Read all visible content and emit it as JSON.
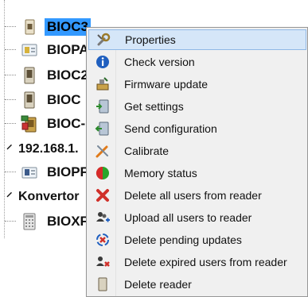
{
  "tree": {
    "nodes": [
      {
        "label": "BIOC3",
        "icon": "reader-device-icon",
        "selected": true
      },
      {
        "label": "BIOPA",
        "icon": "reader-device-icon"
      },
      {
        "label": "BIOC2",
        "icon": "reader-device-icon"
      },
      {
        "label": "BIOC",
        "icon": "reader-device-icon"
      },
      {
        "label": "BIOC-",
        "icon": "reader-device-icon"
      },
      {
        "label": "192.168.1.",
        "icon": "network-group"
      },
      {
        "label": "BIOPF",
        "icon": "reader-device-icon"
      },
      {
        "label": "Konvertor",
        "icon": "converter-group"
      },
      {
        "label": "BIOXF",
        "icon": "keypad-reader-icon"
      }
    ]
  },
  "context_menu": {
    "items": [
      {
        "label": "Properties",
        "icon": "properties-icon",
        "highlighted": true
      },
      {
        "label": "Check version",
        "icon": "info-icon"
      },
      {
        "label": "Firmware update",
        "icon": "firmware-update-icon"
      },
      {
        "label": "Get settings",
        "icon": "get-settings-icon"
      },
      {
        "label": "Send configuration",
        "icon": "send-configuration-icon"
      },
      {
        "label": "Calibrate",
        "icon": "calibrate-icon"
      },
      {
        "label": "Memory status",
        "icon": "memory-status-icon"
      },
      {
        "label": "Delete all users from reader",
        "icon": "delete-users-icon"
      },
      {
        "label": "Upload all users to reader",
        "icon": "upload-users-icon"
      },
      {
        "label": "Delete pending updates",
        "icon": "delete-pending-icon"
      },
      {
        "label": "Delete expired users from reader",
        "icon": "delete-expired-users-icon"
      },
      {
        "label": "Delete reader",
        "icon": "delete-reader-icon"
      }
    ]
  },
  "colors": {
    "selection": "#3399ff",
    "menu_background": "#f0f0f0",
    "menu_highlight": "#d5e6f8",
    "menu_highlight_border": "#8fb8e6"
  }
}
